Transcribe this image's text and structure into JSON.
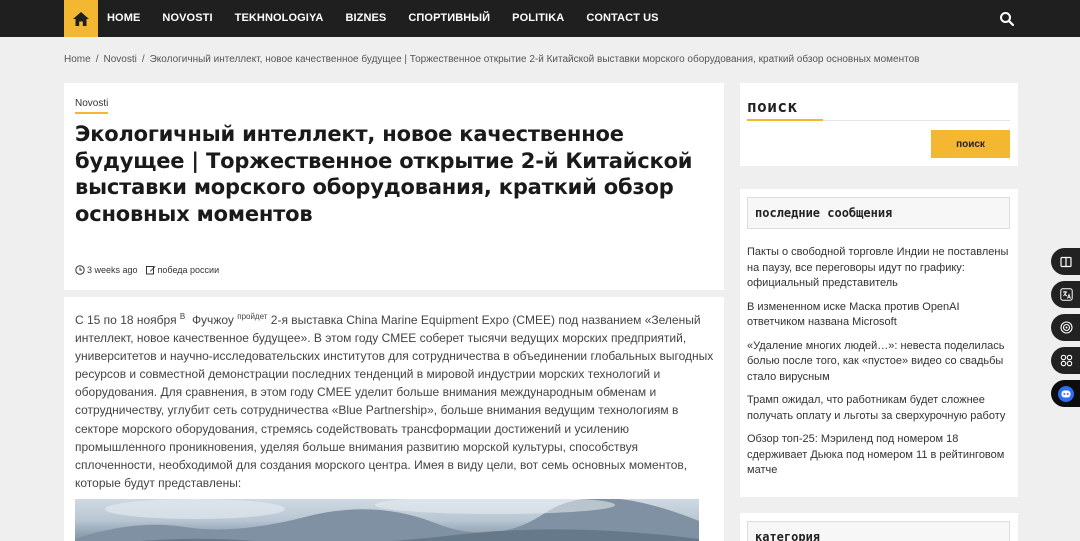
{
  "nav": {
    "items": [
      "HOME",
      "NOVOSTI",
      "TEKHNOLOGIYA",
      "BIZNES",
      "СПОРТИВНЫЙ",
      "POLITIKA",
      "CONTACT US"
    ],
    "accent": "#f4b732",
    "home_icon": "home-icon",
    "search_icon": "search-icon"
  },
  "breadcrumb": {
    "home": "Home",
    "section": "Novosti",
    "current": "Экологичный интеллект, новое качественное будущее | Торжественное открытие 2-й Китайской выставки морского оборудования, краткий обзор основных моментов"
  },
  "article": {
    "category": "Novosti",
    "title": "Экологичный интеллект, новое качественное будущее | Торжественное открытие 2-й Китайской выставки морского оборудования, краткий обзор основных моментов",
    "date": "3 weeks ago",
    "tag": "победа россии",
    "body_pre": "С 15 по 18 ноября",
    "sup1": "В",
    "body_city": "Фучжоу",
    "sup2": "пройдет",
    "body_main": "2-я выставка China Marine Equipment Expo (CMEE) под названием «Зеленый интеллект, новое качественное будущее». В этом году CMEE соберет тысячи ведущих морских предприятий, университетов и научно-исследовательских институтов для сотрудничества в объединении глобальных выгодных ресурсов и совместной демонстрации последних тенденций в мировой индустрии морских технологий и оборудования. Для сравнения, в этом году CMEE уделит больше внимания международным обменам и сотрудничеству, углубит сеть сотрудничества «Blue Partnership», больше внимания ведущим технологиям в секторе морского оборудования, стремясь содействовать трансформации достижений и усилению промышленного проникновения, уделяя больше внимания развитию морской культуры, способствуя сплоченности, необходимой для создания морского центра. Имея в виду цели, вот семь основных моментов, которые будут представлены:"
  },
  "sidebar": {
    "search_title": "поиск",
    "search_button": "поиск",
    "search_placeholder": "",
    "recent_title": "последние сообщения",
    "recent": [
      "Пакты о свободной торговле Индии не поставлены на паузу, все переговоры идут по графику: официальный представитель",
      "В измененном иске Маска против OpenAI ответчиком названа Microsoft",
      "«Удаление многих людей…»: невеста поделилась болью после того, как «пустое» видео со свадьбы стало вирусным",
      "Трамп ожидал, что работникам будет сложнее получать оплату и льготы за сверхурочную работу",
      "Обзор топ-25: Мэриленд под номером 18 сдерживает Дьюка под номером 11 в рейтинговом матче"
    ],
    "category_title": "категория"
  },
  "floating": [
    "book-icon",
    "translate-icon",
    "podcast-icon",
    "apps-icon",
    "assistant-icon"
  ]
}
